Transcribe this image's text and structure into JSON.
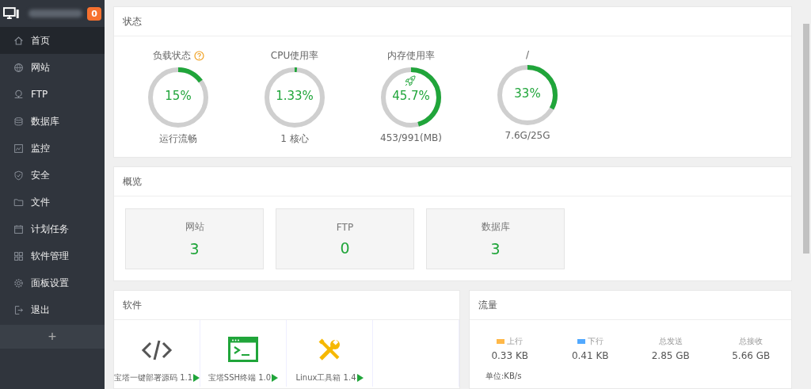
{
  "sidebar": {
    "badge": "0",
    "items": [
      {
        "label": "首页",
        "selected": true
      },
      {
        "label": "网站",
        "selected": false
      },
      {
        "label": "FTP",
        "selected": false
      },
      {
        "label": "数据库",
        "selected": false
      },
      {
        "label": "监控",
        "selected": false
      },
      {
        "label": "安全",
        "selected": false
      },
      {
        "label": "文件",
        "selected": false
      },
      {
        "label": "计划任务",
        "selected": false
      },
      {
        "label": "软件管理",
        "selected": false
      },
      {
        "label": "面板设置",
        "selected": false
      },
      {
        "label": "退出",
        "selected": false
      }
    ],
    "add_button": "+"
  },
  "status": {
    "title": "状态",
    "gauges": [
      {
        "label": "负载状态",
        "help": true,
        "value": "15%",
        "level": 0.15,
        "caption": "运行流畅",
        "rocket": false
      },
      {
        "label": "CPU使用率",
        "help": false,
        "value": "1.33%",
        "level": 0.0133,
        "caption": "1 核心",
        "rocket": false
      },
      {
        "label": "内存使用率",
        "help": false,
        "value": "45.7%",
        "level": 0.457,
        "caption": "453/991(MB)",
        "rocket": true
      },
      {
        "label": "/",
        "help": false,
        "value": "33%",
        "level": 0.33,
        "caption": "7.6G/25G",
        "rocket": false
      }
    ]
  },
  "overview": {
    "title": "概览",
    "stats": [
      {
        "label": "网站",
        "value": "3"
      },
      {
        "label": "FTP",
        "value": "0"
      },
      {
        "label": "数据库",
        "value": "3"
      }
    ]
  },
  "software": {
    "title": "软件",
    "items": [
      {
        "label": "宝塔一键部署源码 1.1"
      },
      {
        "label": "宝塔SSH终端 1.0"
      },
      {
        "label": "Linux工具箱 1.4"
      }
    ]
  },
  "traffic": {
    "title": "流量",
    "stats": [
      {
        "label": "上行",
        "value": "0.33 KB",
        "color": "#ffb848"
      },
      {
        "label": "下行",
        "value": "0.41 KB",
        "color": "#52a9ff"
      },
      {
        "label": "总发送",
        "value": "2.85 GB"
      },
      {
        "label": "总接收",
        "value": "5.66 GB"
      }
    ],
    "unit": "单位:KB/s"
  }
}
